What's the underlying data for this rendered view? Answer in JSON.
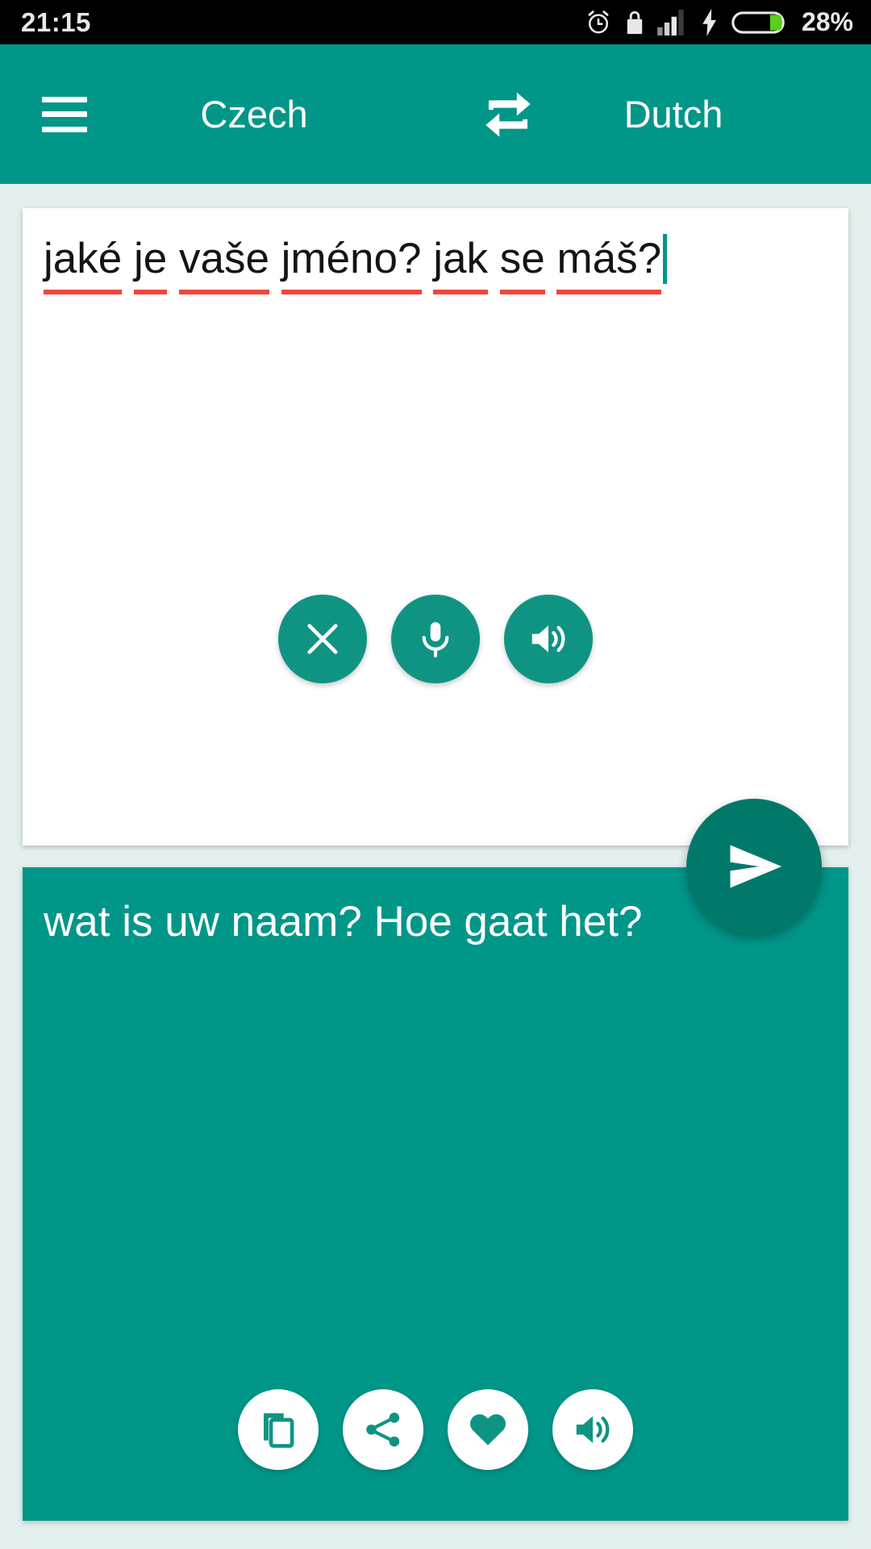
{
  "status_bar": {
    "time": "21:15",
    "battery_percent": "28%",
    "icons": [
      "alarm-icon",
      "lock-icon",
      "signal-icon",
      "charging-bolt-icon",
      "battery-icon"
    ]
  },
  "toolbar": {
    "menu_icon": "hamburger-menu-icon",
    "source_language": "Czech",
    "swap_icon": "swap-languages-icon",
    "target_language": "Dutch",
    "background_color": "#009688"
  },
  "input_card": {
    "words": [
      "jaké",
      "je",
      "vaše",
      "jméno?",
      "jak",
      "se",
      "máš?"
    ],
    "text": "jaké je vaše jméno? jak se máš?",
    "spellcheck_underline_color": "#f2453d",
    "caret_color": "#009688",
    "actions": [
      {
        "name": "clear-button",
        "icon": "close-icon",
        "label": "Clear"
      },
      {
        "name": "microphone-button",
        "icon": "microphone-icon",
        "label": "Speak"
      },
      {
        "name": "speak-input-button",
        "icon": "volume-icon",
        "label": "Listen"
      }
    ]
  },
  "send_button": {
    "name": "send-button",
    "icon": "send-icon",
    "label": "Translate",
    "color": "#00796b"
  },
  "output_card": {
    "text": "wat is uw naam? Hoe gaat het?",
    "background_color": "#009688",
    "actions": [
      {
        "name": "copy-button",
        "icon": "copy-icon",
        "label": "Copy"
      },
      {
        "name": "share-button",
        "icon": "share-icon",
        "label": "Share"
      },
      {
        "name": "favorite-button",
        "icon": "heart-icon",
        "label": "Favorite"
      },
      {
        "name": "speak-output-button",
        "icon": "volume-icon",
        "label": "Listen"
      }
    ]
  },
  "page": {
    "background_color": "#e2efed"
  }
}
